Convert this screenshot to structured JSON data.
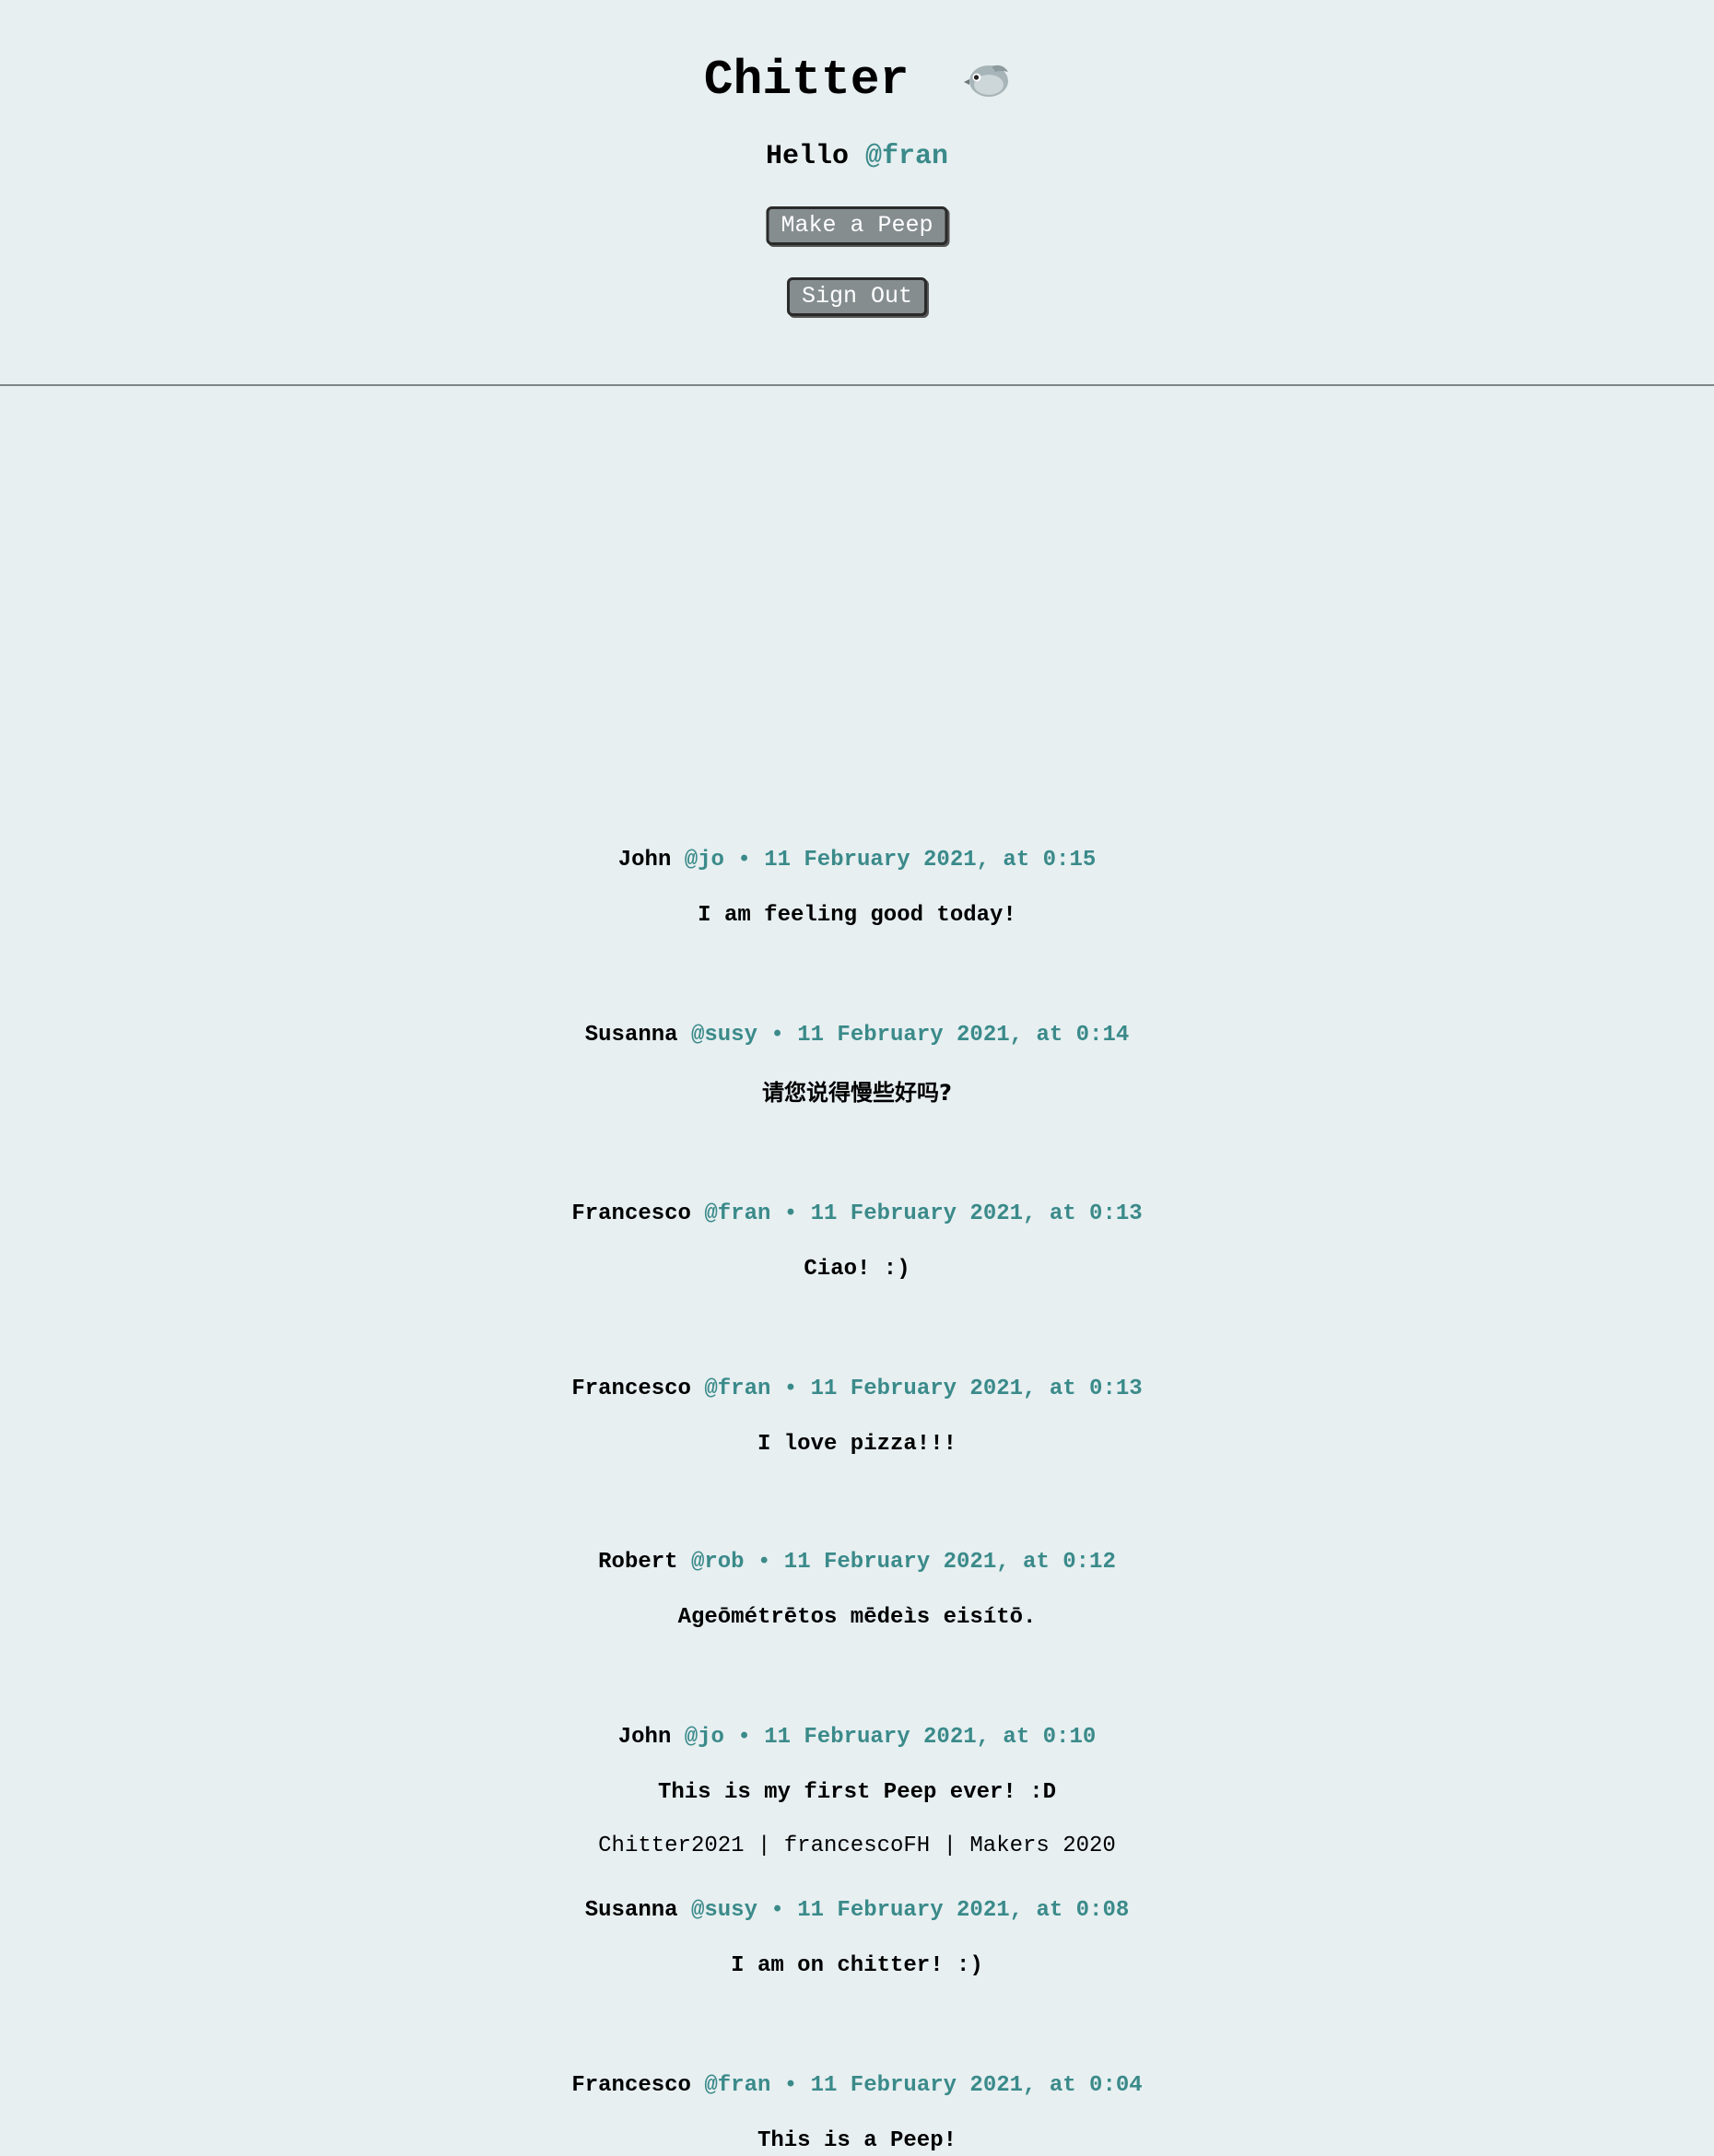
{
  "header": {
    "title": "Chitter",
    "greeting_prefix": "Hello",
    "username": "@fran",
    "make_peep_label": "Make a Peep",
    "sign_out_label": "Sign Out"
  },
  "colors": {
    "background": "#e7eff1",
    "accent": "#3b8a8a",
    "button_bg": "#858d8f"
  },
  "peeps": [
    {
      "name": "John",
      "handle": "@jo",
      "date": "11 February 2021, at 0:15",
      "text": "I am feeling good today!"
    },
    {
      "name": "Susanna",
      "handle": "@susy",
      "date": "11 February 2021, at 0:14",
      "text": "请您说得慢些好吗?"
    },
    {
      "name": "Francesco",
      "handle": "@fran",
      "date": "11 February 2021, at 0:13",
      "text": "Ciao! :)"
    },
    {
      "name": "Francesco",
      "handle": "@fran",
      "date": "11 February 2021, at 0:13",
      "text": "I love pizza!!!"
    },
    {
      "name": "Robert",
      "handle": "@rob",
      "date": "11 February 2021, at 0:12",
      "text": "Ageōmétrētos mēdeìs eisítō."
    },
    {
      "name": "John",
      "handle": "@jo",
      "date": "11 February 2021, at 0:10",
      "text": "This is my first Peep ever! :D"
    },
    {
      "name": "Susanna",
      "handle": "@susy",
      "date": "11 February 2021, at 0:08",
      "text": "I am on chitter! :)"
    },
    {
      "name": "Francesco",
      "handle": "@fran",
      "date": "11 February 2021, at 0:04",
      "text": "This is a Peep!"
    }
  ],
  "footer": {
    "text": "Chitter2021 | francescoFH | Makers 2020"
  }
}
